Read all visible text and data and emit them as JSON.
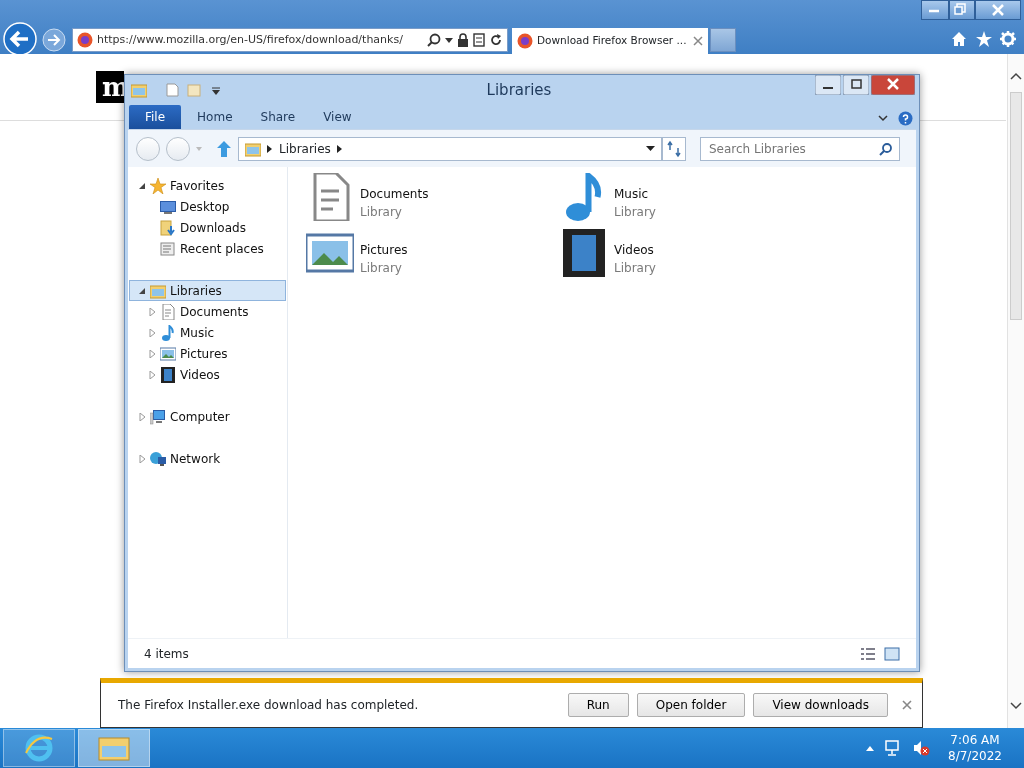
{
  "browser": {
    "address": "https://www.mozilla.org/en-US/firefox/download/thanks/",
    "tab_title": "Download Firefox Browser ...",
    "page": {
      "logo": "m"
    }
  },
  "explorer": {
    "title": "Libraries",
    "ribbon_tabs": [
      {
        "label": "File",
        "kind": "file"
      },
      {
        "label": "Home",
        "kind": "tab"
      },
      {
        "label": "Share",
        "kind": "tab"
      },
      {
        "label": "View",
        "kind": "tab"
      }
    ],
    "breadcrumb": [
      "Libraries"
    ],
    "search": {
      "placeholder": "Search Libraries"
    },
    "nav_tree": [
      {
        "label": "Favorites",
        "kind": "star",
        "expanded": true,
        "selected": false,
        "children": [
          {
            "label": "Desktop",
            "kind": "desktop",
            "selected": false
          },
          {
            "label": "Downloads",
            "kind": "downloads",
            "selected": false
          },
          {
            "label": "Recent places",
            "kind": "recent",
            "selected": false
          }
        ]
      },
      {
        "label": "Libraries",
        "kind": "library",
        "expanded": true,
        "selected": true,
        "children": [
          {
            "label": "Documents",
            "kind": "document",
            "expanded": false,
            "selected": false
          },
          {
            "label": "Music",
            "kind": "music",
            "expanded": false,
            "selected": false
          },
          {
            "label": "Pictures",
            "kind": "picture",
            "expanded": false,
            "selected": false
          },
          {
            "label": "Videos",
            "kind": "video",
            "expanded": false,
            "selected": false
          }
        ]
      },
      {
        "label": "Computer",
        "kind": "computer",
        "expanded": false,
        "selected": false
      },
      {
        "label": "Network",
        "kind": "network",
        "expanded": false,
        "selected": false
      }
    ],
    "items": [
      {
        "name": "Documents",
        "type": "Library",
        "kind": "document"
      },
      {
        "name": "Music",
        "type": "Library",
        "kind": "music"
      },
      {
        "name": "Pictures",
        "type": "Library",
        "kind": "picture"
      },
      {
        "name": "Videos",
        "type": "Library",
        "kind": "video"
      }
    ],
    "status": "4 items"
  },
  "download_bar": {
    "message": "The Firefox Installer.exe download has completed.",
    "buttons": [
      "Run",
      "Open folder",
      "View downloads"
    ]
  },
  "taskbar": {
    "time": "7:06 AM",
    "date": "8/7/2022"
  }
}
